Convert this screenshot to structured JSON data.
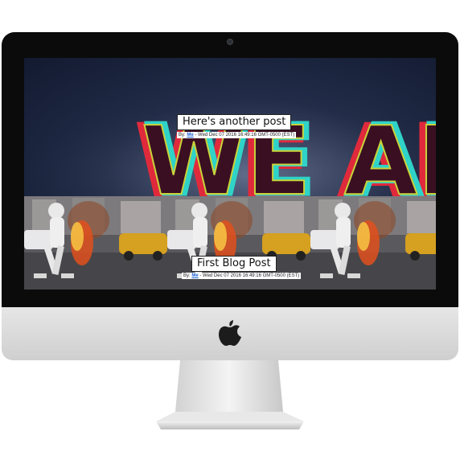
{
  "device": {
    "brand_logo": "apple-icon"
  },
  "posts": [
    {
      "title": "Here's another post",
      "meta_prefix": "By: ",
      "author": "Me",
      "meta_suffix": " - Wed Dec 07 2016 16:49:16 GMT-0500 (EST)",
      "hero_text": "WE ARE"
    },
    {
      "title": "First Blog Post",
      "meta_prefix": "By: ",
      "author": "Me",
      "meta_suffix": " - Wed Dec 07 2016 16:49:16 GMT-0500 (EST)"
    }
  ],
  "colors": {
    "bezel": "#0b0b0b",
    "chin": "#d9d9d9",
    "link": "#1a5fd6"
  }
}
